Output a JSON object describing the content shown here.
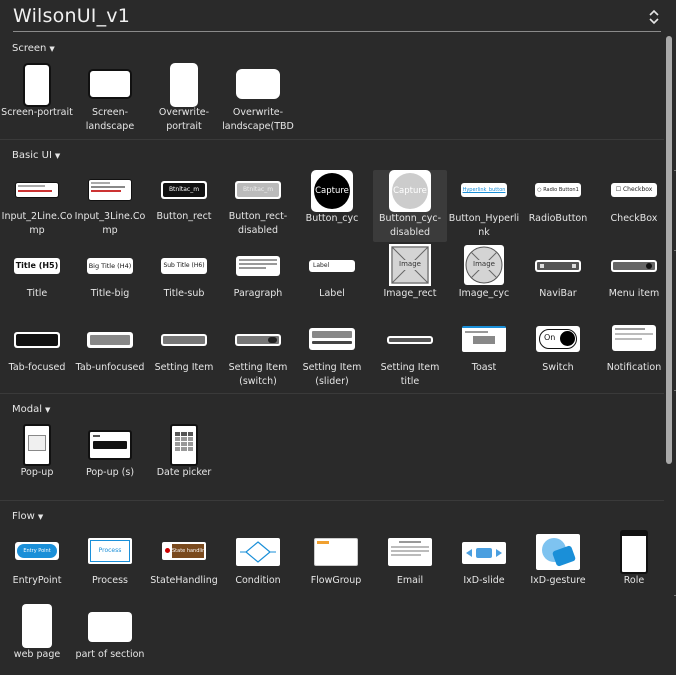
{
  "header": {
    "title": "WilsonUI_v1"
  },
  "sections": {
    "screen": "Screen",
    "basic": "Basic UI",
    "modal": "Modal",
    "flow": "Flow"
  },
  "screen": [
    "Screen-portrait",
    "Screen-\nlandscape",
    "Overwrite-\nportrait",
    "Overwrite-\nlandscape(TBD"
  ],
  "basic": {
    "row1": [
      "Input_2Line.Co\nmp",
      "Input_3Line.Co\nmp",
      "Button_rect",
      "Button_rect-\ndisabled",
      "Button_cyc",
      "Buttonn_cyc-\ndisabled",
      "Button_Hyperli\nnk",
      "RadioButton",
      "CheckBox"
    ],
    "row2": [
      "Title",
      "Title-big",
      "Title-sub",
      "Paragraph",
      "Label",
      "Image_rect",
      "Image_cyc",
      "NaviBar",
      "Menu item"
    ],
    "row3": [
      "Tab-focused",
      "Tab-unfocused",
      "Setting Item",
      "Setting Item\n(switch)",
      "Setting Item\n(slider)",
      "Setting Item\ntitle",
      "Toast",
      "Switch",
      "Notification"
    ]
  },
  "modal": [
    "Pop-up",
    "Pop-up (s)",
    "Date picker"
  ],
  "flow": {
    "row1": [
      "EntryPoint",
      "Process",
      "StateHandling",
      "Condition",
      "FlowGroup",
      "Email",
      "IxD-slide",
      "IxD-gesture",
      "Role"
    ],
    "row2": [
      "web page",
      "part of section"
    ]
  },
  "thumbs": {
    "btn_rect": "Btnltac_m",
    "btn_rect_dis": "Btnltac_m",
    "capture": "Capture",
    "hyperlink": "Hyperlink_button",
    "radio": "Radio Button1",
    "checkbox": "Checkbox",
    "title_h5": "Title (H5)",
    "title_h4": "Big Title (H4)",
    "title_h6": "Sub Title (H6)",
    "label": "Label",
    "image": "Image",
    "on": "On",
    "entry": "Entry Point",
    "process": "Process",
    "state": "State handling"
  },
  "colors": {
    "bg": "#2a2a2a",
    "accent": "#1a8fd8",
    "selected": "#3b3b3b"
  }
}
